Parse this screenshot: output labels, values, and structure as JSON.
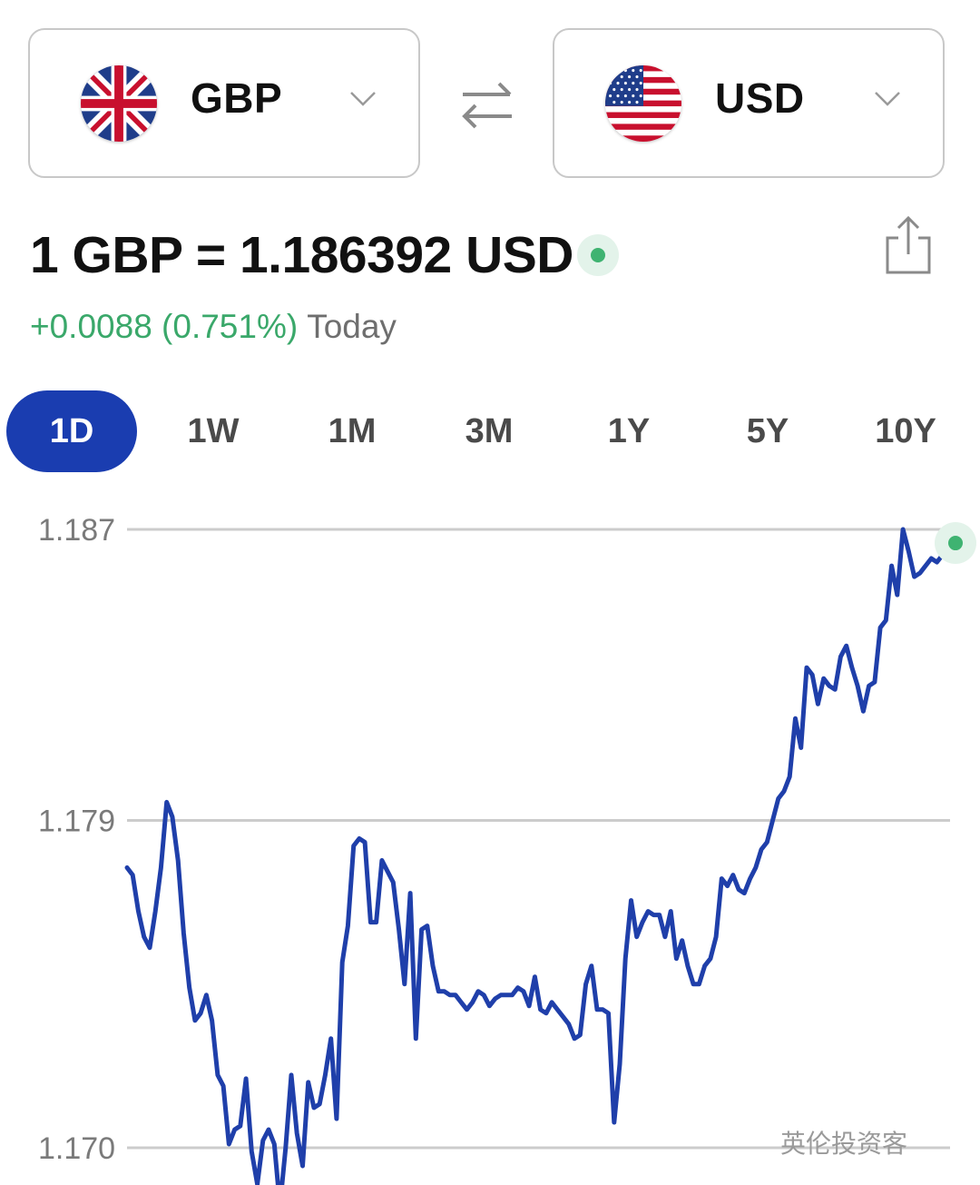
{
  "converter": {
    "from": {
      "code": "GBP",
      "flag": "uk-flag-icon"
    },
    "to": {
      "code": "USD",
      "flag": "us-flag-icon"
    },
    "swap_icon": "swap-arrows-icon"
  },
  "rate": {
    "text": "1 GBP = 1.186392 USD",
    "change": "+0.0088 (0.751%)",
    "period": "Today",
    "share_icon": "share-icon"
  },
  "tabs": [
    "1D",
    "1W",
    "1M",
    "3M",
    "1Y",
    "5Y",
    "10Y"
  ],
  "active_tab": "1D",
  "colors": {
    "accent": "#1a3db0",
    "positive": "#3aa86a",
    "line": "#1f3faa",
    "grid": "#cccccc"
  },
  "watermark": "英伦投资客",
  "chart_data": {
    "type": "line",
    "title": "",
    "xlabel": "",
    "ylabel": "",
    "y_ticks": [
      "1.187",
      "1.179",
      "1.170"
    ],
    "ylim": [
      1.17,
      1.187
    ],
    "grid": true,
    "series": [
      {
        "values": [
          1.1777,
          1.1775,
          1.1765,
          1.1758,
          1.1755,
          1.1765,
          1.1777,
          1.1795,
          1.1791,
          1.1779,
          1.1759,
          1.1744,
          1.1735,
          1.1737,
          1.1742,
          1.1735,
          1.172,
          1.1717,
          1.1701,
          1.1705,
          1.1706,
          1.1719,
          1.1699,
          1.169,
          1.1702,
          1.1705,
          1.1701,
          1.1684,
          1.17,
          1.172,
          1.1704,
          1.1695,
          1.1718,
          1.1711,
          1.1712,
          1.172,
          1.173,
          1.1708,
          1.1751,
          1.1761,
          1.1783,
          1.1785,
          1.1784,
          1.1762,
          1.1762,
          1.1779,
          1.1776,
          1.1773,
          1.176,
          1.1745,
          1.177,
          1.173,
          1.176,
          1.1761,
          1.175,
          1.1743,
          1.1743,
          1.1742,
          1.1742,
          1.174,
          1.1738,
          1.174,
          1.1743,
          1.1742,
          1.1739,
          1.1741,
          1.1742,
          1.1742,
          1.1742,
          1.1744,
          1.1743,
          1.1739,
          1.1747,
          1.1738,
          1.1737,
          1.174,
          1.1738,
          1.1736,
          1.1734,
          1.173,
          1.1731,
          1.1745,
          1.175,
          1.1738,
          1.1738,
          1.1737,
          1.1707,
          1.1723,
          1.1752,
          1.1768,
          1.1758,
          1.1762,
          1.1765,
          1.1764,
          1.1764,
          1.1758,
          1.1765,
          1.1752,
          1.1757,
          1.175,
          1.1745,
          1.1745,
          1.175,
          1.1752,
          1.1758,
          1.1774,
          1.1772,
          1.1775,
          1.1771,
          1.177,
          1.1774,
          1.1777,
          1.1782,
          1.1784,
          1.179,
          1.1796,
          1.1798,
          1.1802,
          1.1818,
          1.181,
          1.1832,
          1.183,
          1.1822,
          1.1829,
          1.1827,
          1.1826,
          1.1835,
          1.1838,
          1.1832,
          1.1827,
          1.182,
          1.1827,
          1.1828,
          1.1843,
          1.1845,
          1.186,
          1.1852,
          1.187,
          1.1864,
          1.1857,
          1.1858,
          1.186,
          1.1862,
          1.1861,
          1.1863,
          1.1864
        ]
      }
    ]
  }
}
